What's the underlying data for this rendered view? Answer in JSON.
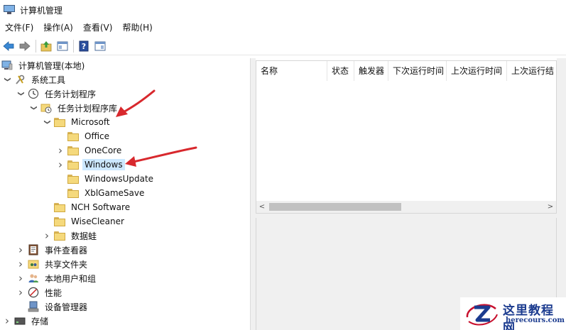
{
  "window": {
    "title": "计算机管理"
  },
  "menu": [
    "文件(F)",
    "操作(A)",
    "查看(V)",
    "帮助(H)"
  ],
  "toolbar": [
    "back-icon",
    "forward-icon",
    "up-folder-icon",
    "show-hide-tree-icon",
    "help-icon",
    "properties-icon"
  ],
  "tree": {
    "root": "计算机管理(本地)",
    "system_tools": "系统工具",
    "task_scheduler": "任务计划程序",
    "task_library": "任务计划程序库",
    "microsoft": "Microsoft",
    "office": "Office",
    "onecore": "OneCore",
    "windows": "Windows",
    "windows_update": "WindowsUpdate",
    "xbl_game_save": "XblGameSave",
    "nch_software": "NCH Software",
    "wise_cleaner": "WiseCleaner",
    "data_fox": "数据蛙",
    "event_viewer": "事件查看器",
    "shared_folders": "共享文件夹",
    "local_users": "本地用户和组",
    "performance": "性能",
    "device_manager": "设备管理器",
    "storage": "存储"
  },
  "columns": [
    "名称",
    "状态",
    "触发器",
    "下次运行时间",
    "上次运行时间",
    "上次运行结"
  ],
  "watermark": {
    "title": "这里教程网",
    "url": "herecours.com"
  },
  "colors": {
    "selection": "#cce8ff",
    "arrow": "#d8282d",
    "folder": "#f5d97c",
    "watermark": "#1b3b8f"
  }
}
